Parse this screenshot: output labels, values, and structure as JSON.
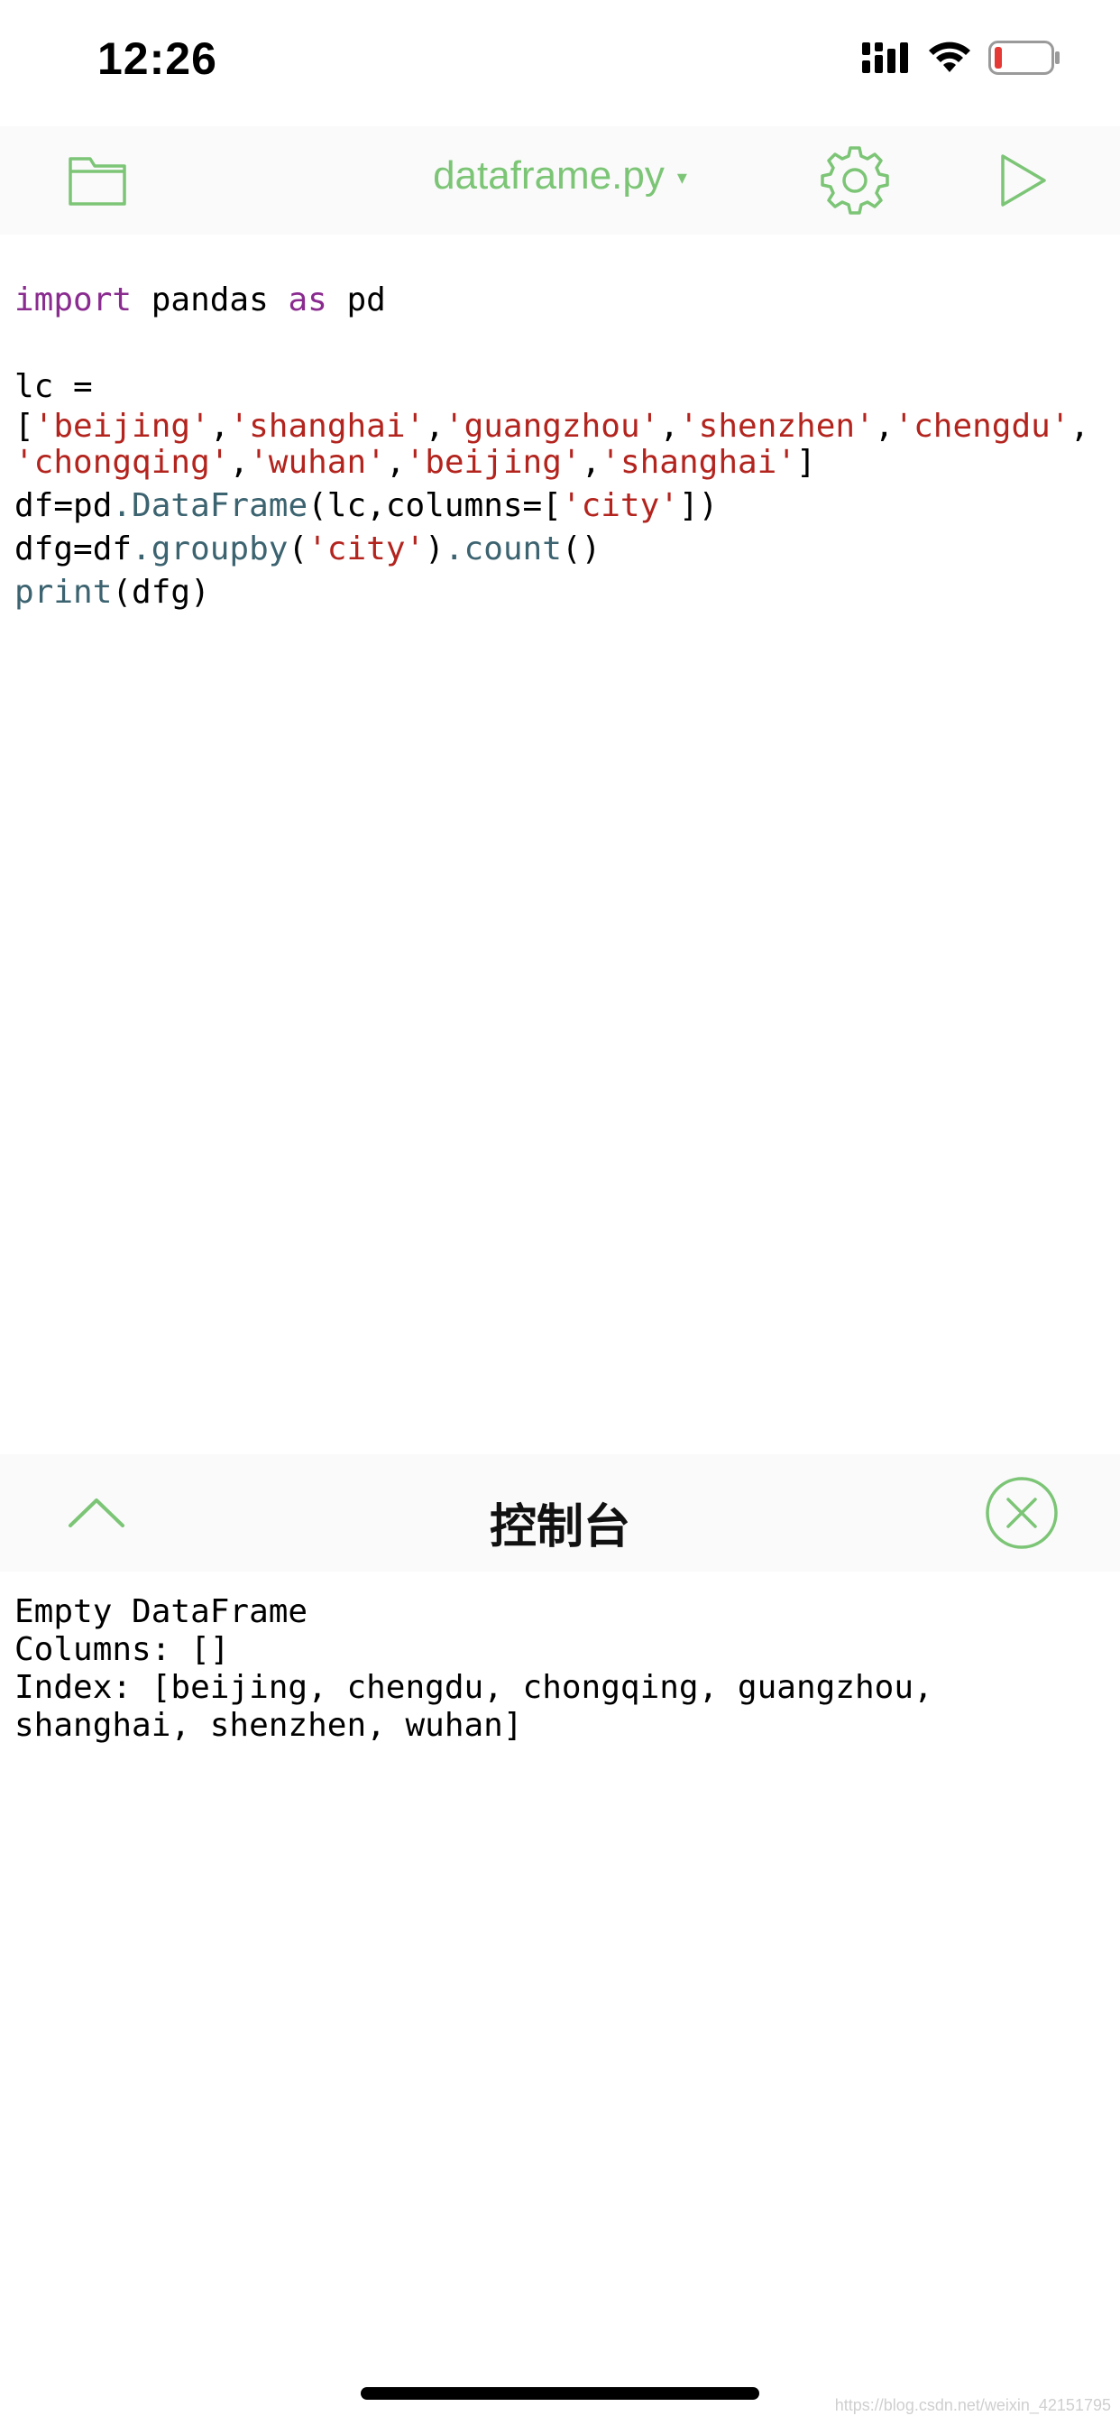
{
  "status_bar": {
    "time": "12:26",
    "icons": [
      "signal-icon",
      "wifi-icon",
      "battery-low-icon"
    ],
    "battery_color": "#e53935"
  },
  "toolbar": {
    "filename": "dataframe.py",
    "caret": "▾",
    "icons": [
      "folder-icon",
      "gear-icon",
      "play-icon"
    ],
    "accent": "#7cc576"
  },
  "editor": {
    "lines": [
      {
        "tokens": [
          {
            "t": "import",
            "c": "kw"
          },
          {
            "t": " pandas ",
            "c": ""
          },
          {
            "t": "as",
            "c": "kw"
          },
          {
            "t": " pd",
            "c": ""
          }
        ]
      },
      {
        "tokens": []
      },
      {
        "tokens": [
          {
            "t": "lc =",
            "c": ""
          }
        ]
      },
      {
        "tokens": [
          {
            "t": "[",
            "c": ""
          },
          {
            "t": "'beijing'",
            "c": "str"
          },
          {
            "t": ",",
            "c": ""
          },
          {
            "t": "'shanghai'",
            "c": "str"
          },
          {
            "t": ",",
            "c": ""
          },
          {
            "t": "'guangzhou'",
            "c": "str"
          },
          {
            "t": ",",
            "c": ""
          },
          {
            "t": "'shenzhen'",
            "c": "str"
          },
          {
            "t": ",",
            "c": ""
          },
          {
            "t": "'chengdu'",
            "c": "str"
          },
          {
            "t": ",",
            "c": ""
          }
        ]
      },
      {
        "tokens": [
          {
            "t": "'chongqing'",
            "c": "str"
          },
          {
            "t": ",",
            "c": ""
          },
          {
            "t": "'wuhan'",
            "c": "str"
          },
          {
            "t": ",",
            "c": ""
          },
          {
            "t": "'beijing'",
            "c": "str"
          },
          {
            "t": ",",
            "c": ""
          },
          {
            "t": "'shanghai'",
            "c": "str"
          },
          {
            "t": "]",
            "c": ""
          }
        ]
      },
      {
        "tokens": [
          {
            "t": "df=pd",
            "c": ""
          },
          {
            "t": ".DataFrame",
            "c": "fn"
          },
          {
            "t": "(lc,columns=[",
            "c": ""
          },
          {
            "t": "'city'",
            "c": "str"
          },
          {
            "t": "])",
            "c": ""
          }
        ]
      },
      {
        "tokens": [
          {
            "t": "dfg=df",
            "c": ""
          },
          {
            "t": ".groupby",
            "c": "fn"
          },
          {
            "t": "(",
            "c": ""
          },
          {
            "t": "'city'",
            "c": "str"
          },
          {
            "t": ")",
            "c": ""
          },
          {
            "t": ".count",
            "c": "fn"
          },
          {
            "t": "()",
            "c": ""
          }
        ]
      },
      {
        "tokens": [
          {
            "t": "print",
            "c": "fn"
          },
          {
            "t": "(dfg)",
            "c": ""
          }
        ]
      }
    ]
  },
  "console": {
    "title": "控制台",
    "icons": [
      "chevron-up-icon",
      "close-circle-icon"
    ],
    "output": [
      "Empty DataFrame",
      "Columns: []",
      "Index: [beijing, chengdu, chongqing, guangzhou,",
      "shanghai, shenzhen, wuhan]"
    ]
  },
  "watermark": "https://blog.csdn.net/weixin_42151795"
}
